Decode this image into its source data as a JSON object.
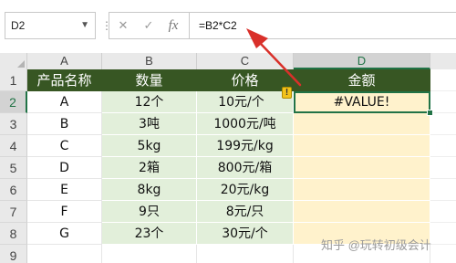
{
  "formula_bar": {
    "name_box": "D2",
    "cancel_glyph": "✕",
    "enter_glyph": "✓",
    "fx_label": "fx",
    "formula": "=B2*C2"
  },
  "columns": [
    "A",
    "B",
    "C",
    "D"
  ],
  "rows": [
    "1",
    "2",
    "3",
    "4",
    "5",
    "6",
    "7",
    "8",
    "9"
  ],
  "active_cell": {
    "column": "D",
    "row": "2"
  },
  "table": {
    "headers": [
      "产品名称",
      "数量",
      "价格",
      "金额"
    ],
    "data": [
      [
        "A",
        "12个",
        "10元/个",
        "#VALUE!"
      ],
      [
        "B",
        "3吨",
        "1000元/吨",
        ""
      ],
      [
        "C",
        "5kg",
        "199元/kg",
        ""
      ],
      [
        "D",
        "2箱",
        "800元/箱",
        ""
      ],
      [
        "E",
        "8kg",
        "20元/kg",
        ""
      ],
      [
        "F",
        "9只",
        "8元/只",
        ""
      ],
      [
        "G",
        "23个",
        "30元/个",
        ""
      ]
    ]
  },
  "error_indicator": "!",
  "watermark": "知乎 @玩转初级会计",
  "colors": {
    "header_fill": "#375623",
    "qty_price_fill": "#e2efda",
    "amount_fill": "#fff2cc",
    "selection": "#217346",
    "annotation_arrow": "#d9302a"
  }
}
